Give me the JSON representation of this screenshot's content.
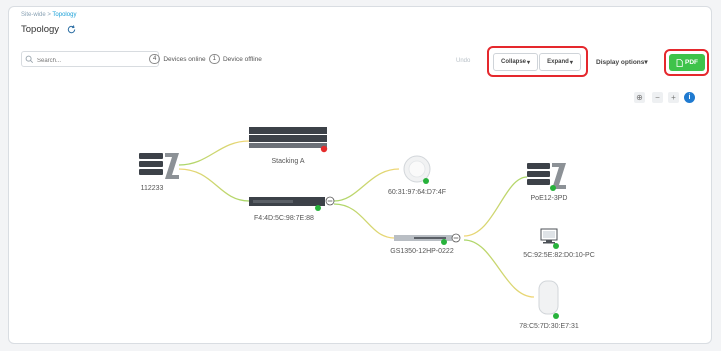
{
  "breadcrumb": {
    "parent": "Site-wide",
    "separator": " > ",
    "current": "Topology"
  },
  "page_title": "Topology",
  "toolbar": {
    "search_placeholder": "Search...",
    "online_count": "4",
    "online_label": "Devices online",
    "offline_count": "1",
    "offline_label": "Device offline",
    "undo_label": "Undo",
    "collapse_label": "Collapse",
    "expand_label": "Expand",
    "display_options_label": "Display options",
    "pdf_label": "PDF"
  },
  "zoom_controls": {
    "fit": "⊕",
    "zoom_out": "−",
    "zoom_in": "+",
    "info": "i"
  },
  "colors": {
    "accent_red": "#e5282d",
    "pdf_green": "#3ec34a",
    "status_online": "#27b23b",
    "status_offline": "#e52b2b",
    "link_green": "#a6d668",
    "link_yellow": "#f2d676",
    "device_dark": "#3c4148"
  },
  "devices": [
    {
      "id": "gateway",
      "label": "112233",
      "icon": "gateway-icon"
    },
    {
      "id": "stack",
      "label": "Stacking A",
      "icon": "switch-stack-icon",
      "status": "offline"
    },
    {
      "id": "switch1",
      "label": "F4:4D:5C:98:7E:88",
      "icon": "switch-icon",
      "status": "online"
    },
    {
      "id": "ap",
      "label": "60:31:97:64:D7:4F",
      "icon": "access-point-icon",
      "status": "online"
    },
    {
      "id": "switch2",
      "label": "GS1350-12HP-0222",
      "icon": "poe-switch-icon",
      "status": "online"
    },
    {
      "id": "poe",
      "label": "PoE12-3PD",
      "icon": "gateway-icon",
      "status": "online"
    },
    {
      "id": "pc",
      "label": "5C:92:5E:82:D0:10-PC",
      "icon": "pc-icon",
      "status": "online"
    },
    {
      "id": "ap2",
      "label": "78:C5:7D:30:E7:31",
      "icon": "access-point-icon",
      "status": "online"
    }
  ]
}
